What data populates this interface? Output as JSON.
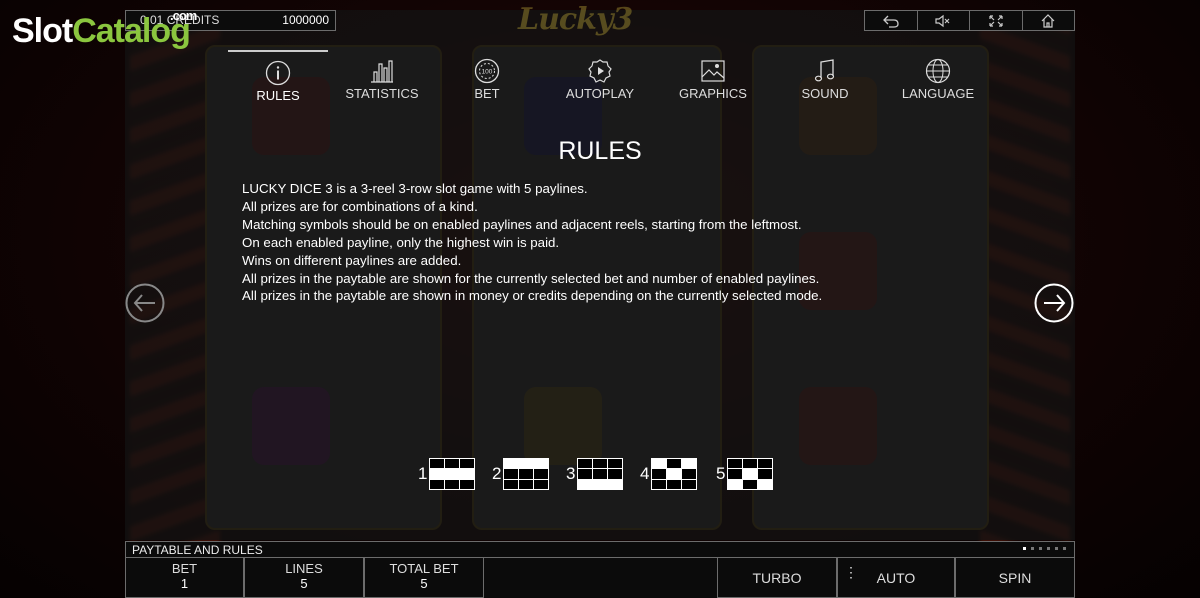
{
  "watermark": {
    "part1": "Slot",
    "part2": "Catalog",
    "suffix": ".com"
  },
  "top_bar": {
    "credits_label": "0.01 CREDITS",
    "credits_value": "1000000",
    "logo_text": "Lucky3",
    "buttons": [
      {
        "icon": "back-icon"
      },
      {
        "icon": "sound-off-icon"
      },
      {
        "icon": "fullscreen-icon"
      },
      {
        "icon": "home-icon"
      }
    ]
  },
  "tabs": [
    {
      "label": "RULES",
      "icon": "info-icon",
      "active": true
    },
    {
      "label": "STATISTICS",
      "icon": "bar-chart-icon"
    },
    {
      "label": "BET",
      "icon": "chip-icon"
    },
    {
      "label": "AUTOPLAY",
      "icon": "autoplay-icon"
    },
    {
      "label": "GRAPHICS",
      "icon": "image-icon"
    },
    {
      "label": "SOUND",
      "icon": "music-note-icon"
    },
    {
      "label": "LANGUAGE",
      "icon": "globe-icon"
    }
  ],
  "rules": {
    "title": "RULES",
    "lines": [
      "LUCKY DICE 3 is a 3-reel 3-row slot game with 5 paylines.",
      "All prizes are for combinations of a kind.",
      "Matching symbols should be on enabled paylines and adjacent reels, starting from the leftmost.",
      "On each enabled payline, only the highest win is paid.",
      "Wins on different paylines are added.",
      "All prizes in the paytable are shown for the currently selected bet and number of enabled paylines.",
      "All prizes in the paytable are shown in money or credits depending on the currently selected mode."
    ]
  },
  "paylines": [
    {
      "number": "1",
      "cells": [
        0,
        0,
        0,
        1,
        1,
        1,
        0,
        0,
        0
      ]
    },
    {
      "number": "2",
      "cells": [
        1,
        1,
        1,
        0,
        0,
        0,
        0,
        0,
        0
      ]
    },
    {
      "number": "3",
      "cells": [
        0,
        0,
        0,
        0,
        0,
        0,
        1,
        1,
        1
      ]
    },
    {
      "number": "4",
      "cells": [
        1,
        0,
        1,
        0,
        1,
        0,
        0,
        0,
        0
      ]
    },
    {
      "number": "5",
      "cells": [
        0,
        0,
        0,
        0,
        1,
        0,
        1,
        0,
        1
      ]
    }
  ],
  "bottom": {
    "section_title": "PAYTABLE AND RULES",
    "page_dots": 6,
    "active_dot": 0,
    "bet_label": "BET",
    "bet_value": "1",
    "lines_label": "LINES",
    "lines_value": "5",
    "total_bet_label": "TOTAL BET",
    "total_bet_value": "5",
    "turbo_label": "TURBO",
    "auto_label": "AUTO",
    "spin_label": "SPIN"
  },
  "colors": {
    "brand_green": "#8bc63f",
    "overlay": "#141414",
    "border": "#6c6c6c"
  }
}
